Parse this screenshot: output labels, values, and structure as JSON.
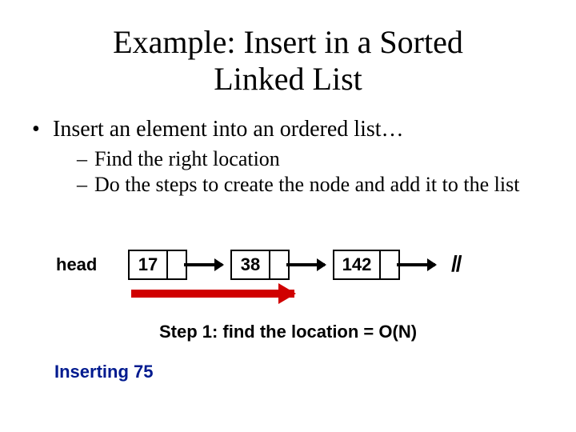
{
  "title": "Example: Insert in a Sorted Linked List",
  "bullets": {
    "b1": "Insert an element into an ordered list…",
    "b2a": "Find the right location",
    "b2b": "Do the steps to create the node and add it to the list"
  },
  "list": {
    "head_label": "head",
    "node1": "17",
    "node2": "38",
    "node3": "142",
    "end": "//"
  },
  "step_caption": "Step 1: find the location = O(N)",
  "inserting": "Inserting 75"
}
